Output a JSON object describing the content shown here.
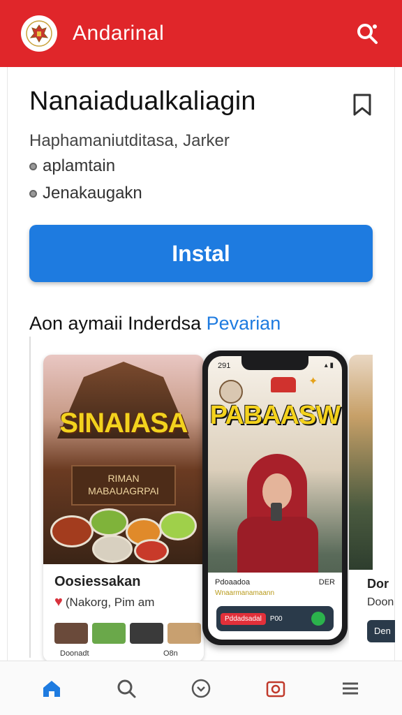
{
  "header": {
    "title": "Andarinal",
    "logo_icon": "garuda-emblem-icon",
    "search_icon": "search-icon",
    "bg_color": "#e0262a"
  },
  "app": {
    "name": "Nanaiadualkaliagin",
    "developer": "Haphamaniutditasa, Jarker",
    "meta1": "aplamtain",
    "meta2": "Jenakaugakn",
    "install_label": "Instal",
    "accent": "#1e7be0"
  },
  "section": {
    "title": "Aon aymaii Inderdsa",
    "link": "Pevarian"
  },
  "gallery": {
    "left_card": {
      "sign": "SINAIASA",
      "shop_sign_line1": "RIMAN",
      "shop_sign_line2": "MABAUAGRPAI",
      "title": "Oosiessakan",
      "sub": "(Nakorg, Pim am",
      "caption1": "Doonadt",
      "caption2": "O8n"
    },
    "phone": {
      "time": "291",
      "big_text": "PABAASW",
      "panel_title": "Pdoaadoa",
      "panel_right": "DER",
      "panel_sub": "Wnaarmanamaann",
      "panel_button": "Pddadsadal",
      "panel_value": "P00"
    },
    "right_card": {
      "title": "Dor",
      "sub": "Doon",
      "button": "Den"
    }
  },
  "bottom_nav": [
    {
      "name": "home",
      "icon": "home-icon"
    },
    {
      "name": "search",
      "icon": "search-icon"
    },
    {
      "name": "explore",
      "icon": "chat-icon"
    },
    {
      "name": "camera",
      "icon": "camera-icon"
    },
    {
      "name": "menu",
      "icon": "menu-icon"
    }
  ]
}
